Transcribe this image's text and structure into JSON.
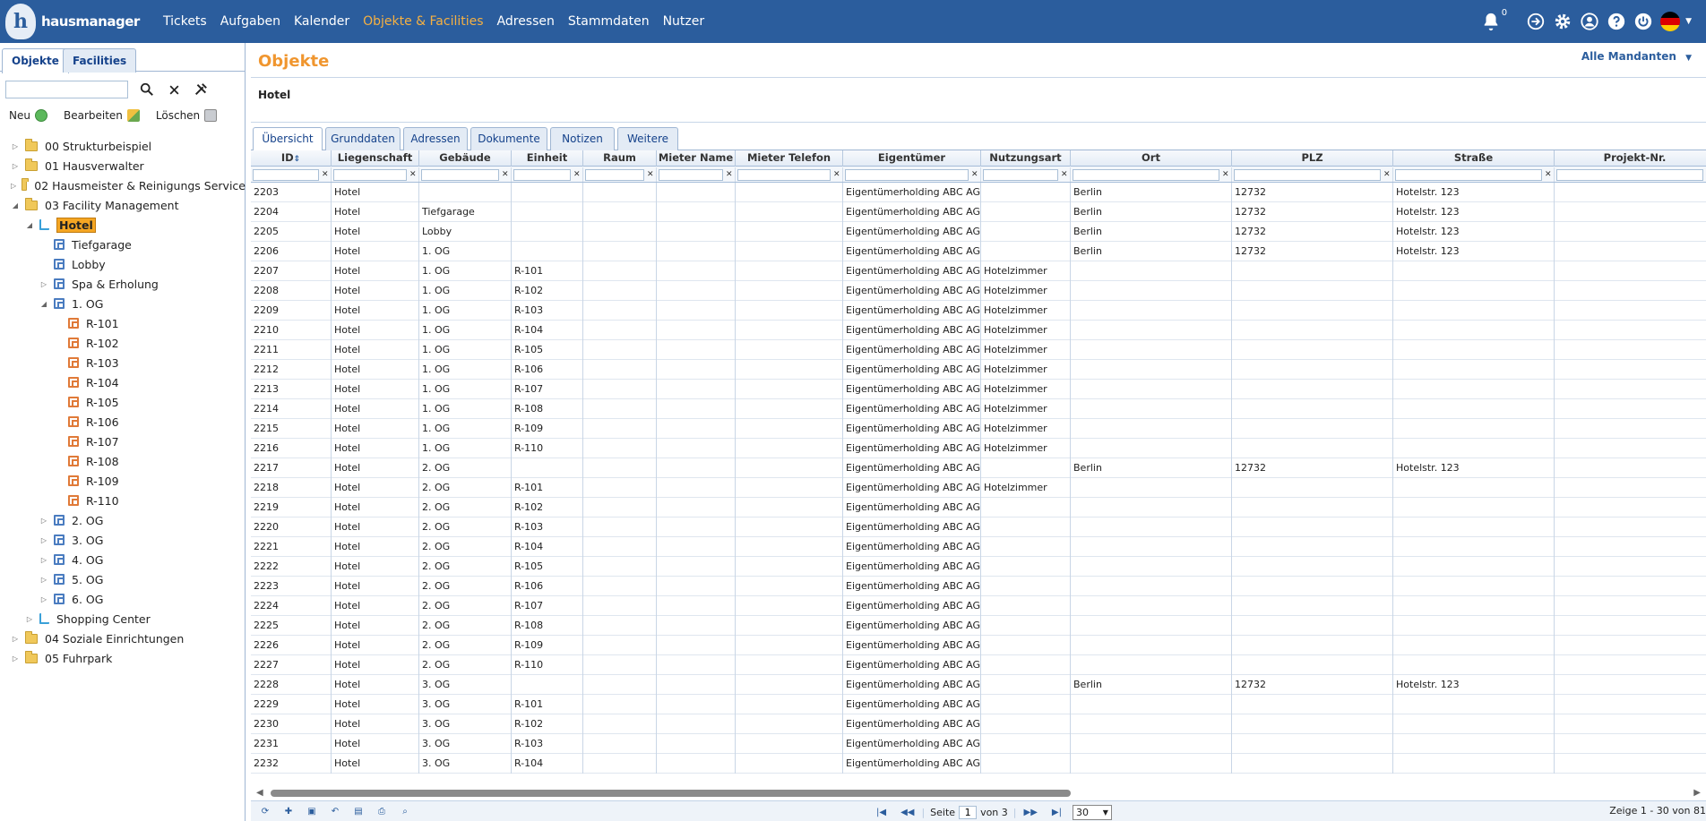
{
  "app": {
    "logo_text": "hausmanager",
    "logo_letter": "h"
  },
  "nav": [
    {
      "label": "Tickets",
      "active": false
    },
    {
      "label": "Aufgaben",
      "active": false
    },
    {
      "label": "Kalender",
      "active": false
    },
    {
      "label": "Objekte & Facilities",
      "active": true
    },
    {
      "label": "Adressen",
      "active": false
    },
    {
      "label": "Stammdaten",
      "active": false
    },
    {
      "label": "Nutzer",
      "active": false
    }
  ],
  "top_icons": {
    "bell_count": "0",
    "icons": [
      "bell-icon",
      "login-icon",
      "gear-icon",
      "user-icon",
      "help-icon",
      "power-icon",
      "flag-de-icon"
    ]
  },
  "left": {
    "tabs": [
      "Objekte",
      "Facilities"
    ],
    "search_value": "",
    "actions": {
      "new": "Neu",
      "edit": "Bearbeiten",
      "delete": "Löschen"
    },
    "tree": [
      {
        "label": "00 Strukturbeispiel",
        "level": 0,
        "toggle": "closed",
        "icon": "folder"
      },
      {
        "label": "01 Hausverwalter",
        "level": 0,
        "toggle": "closed",
        "icon": "folder"
      },
      {
        "label": "02 Hausmeister & Reinigungs Service",
        "level": 0,
        "toggle": "closed",
        "icon": "folder"
      },
      {
        "label": "03 Facility Management",
        "level": 0,
        "toggle": "open",
        "icon": "folder"
      },
      {
        "label": "Hotel",
        "level": 1,
        "toggle": "open",
        "icon": "prop",
        "selected": true
      },
      {
        "label": "Tiefgarage",
        "level": 2,
        "toggle": "none",
        "icon": "bldg"
      },
      {
        "label": "Lobby",
        "level": 2,
        "toggle": "none",
        "icon": "bldg"
      },
      {
        "label": "Spa & Erholung",
        "level": 2,
        "toggle": "closed",
        "icon": "bldg"
      },
      {
        "label": "1. OG",
        "level": 2,
        "toggle": "open",
        "icon": "bldg"
      },
      {
        "label": "R-101",
        "level": 3,
        "toggle": "none",
        "icon": "unit"
      },
      {
        "label": "R-102",
        "level": 3,
        "toggle": "none",
        "icon": "unit"
      },
      {
        "label": "R-103",
        "level": 3,
        "toggle": "none",
        "icon": "unit"
      },
      {
        "label": "R-104",
        "level": 3,
        "toggle": "none",
        "icon": "unit"
      },
      {
        "label": "R-105",
        "level": 3,
        "toggle": "none",
        "icon": "unit"
      },
      {
        "label": "R-106",
        "level": 3,
        "toggle": "none",
        "icon": "unit"
      },
      {
        "label": "R-107",
        "level": 3,
        "toggle": "none",
        "icon": "unit"
      },
      {
        "label": "R-108",
        "level": 3,
        "toggle": "none",
        "icon": "unit"
      },
      {
        "label": "R-109",
        "level": 3,
        "toggle": "none",
        "icon": "unit"
      },
      {
        "label": "R-110",
        "level": 3,
        "toggle": "none",
        "icon": "unit"
      },
      {
        "label": "2. OG",
        "level": 2,
        "toggle": "closed",
        "icon": "bldg"
      },
      {
        "label": "3. OG",
        "level": 2,
        "toggle": "closed",
        "icon": "bldg"
      },
      {
        "label": "4. OG",
        "level": 2,
        "toggle": "closed",
        "icon": "bldg"
      },
      {
        "label": "5. OG",
        "level": 2,
        "toggle": "closed",
        "icon": "bldg"
      },
      {
        "label": "6. OG",
        "level": 2,
        "toggle": "closed",
        "icon": "bldg"
      },
      {
        "label": "Shopping Center",
        "level": 1,
        "toggle": "closed",
        "icon": "prop"
      },
      {
        "label": "04 Soziale Einrichtungen",
        "level": 0,
        "toggle": "closed",
        "icon": "folder"
      },
      {
        "label": "05 Fuhrpark",
        "level": 0,
        "toggle": "closed",
        "icon": "folder"
      }
    ]
  },
  "main": {
    "title": "Objekte",
    "mandanten": "Alle Mandanten",
    "object_name": "Hotel",
    "tabs": [
      "Übersicht",
      "Grunddaten",
      "Adressen",
      "Dokumente",
      "Notizen",
      "Weitere"
    ],
    "columns": [
      "ID",
      "Liegenschaft",
      "Gebäude",
      "Einheit",
      "Raum",
      "Mieter Name",
      "Mieter Telefon",
      "Eigentümer",
      "Nutzungsart",
      "Ort",
      "PLZ",
      "Straße",
      "Projekt-Nr."
    ],
    "rows": [
      [
        "2203",
        "Hotel",
        "",
        "",
        "",
        "",
        "",
        "Eigentümerholding ABC AG",
        "",
        "Berlin",
        "12732",
        "Hotelstr. 123",
        ""
      ],
      [
        "2204",
        "Hotel",
        "Tiefgarage",
        "",
        "",
        "",
        "",
        "Eigentümerholding ABC AG",
        "",
        "Berlin",
        "12732",
        "Hotelstr. 123",
        ""
      ],
      [
        "2205",
        "Hotel",
        "Lobby",
        "",
        "",
        "",
        "",
        "Eigentümerholding ABC AG",
        "",
        "Berlin",
        "12732",
        "Hotelstr. 123",
        ""
      ],
      [
        "2206",
        "Hotel",
        "1. OG",
        "",
        "",
        "",
        "",
        "Eigentümerholding ABC AG",
        "",
        "Berlin",
        "12732",
        "Hotelstr. 123",
        ""
      ],
      [
        "2207",
        "Hotel",
        "1. OG",
        "R-101",
        "",
        "",
        "",
        "Eigentümerholding ABC AG",
        "Hotelzimmer",
        "",
        "",
        "",
        ""
      ],
      [
        "2208",
        "Hotel",
        "1. OG",
        "R-102",
        "",
        "",
        "",
        "Eigentümerholding ABC AG",
        "Hotelzimmer",
        "",
        "",
        "",
        ""
      ],
      [
        "2209",
        "Hotel",
        "1. OG",
        "R-103",
        "",
        "",
        "",
        "Eigentümerholding ABC AG",
        "Hotelzimmer",
        "",
        "",
        "",
        ""
      ],
      [
        "2210",
        "Hotel",
        "1. OG",
        "R-104",
        "",
        "",
        "",
        "Eigentümerholding ABC AG",
        "Hotelzimmer",
        "",
        "",
        "",
        ""
      ],
      [
        "2211",
        "Hotel",
        "1. OG",
        "R-105",
        "",
        "",
        "",
        "Eigentümerholding ABC AG",
        "Hotelzimmer",
        "",
        "",
        "",
        ""
      ],
      [
        "2212",
        "Hotel",
        "1. OG",
        "R-106",
        "",
        "",
        "",
        "Eigentümerholding ABC AG",
        "Hotelzimmer",
        "",
        "",
        "",
        ""
      ],
      [
        "2213",
        "Hotel",
        "1. OG",
        "R-107",
        "",
        "",
        "",
        "Eigentümerholding ABC AG",
        "Hotelzimmer",
        "",
        "",
        "",
        ""
      ],
      [
        "2214",
        "Hotel",
        "1. OG",
        "R-108",
        "",
        "",
        "",
        "Eigentümerholding ABC AG",
        "Hotelzimmer",
        "",
        "",
        "",
        ""
      ],
      [
        "2215",
        "Hotel",
        "1. OG",
        "R-109",
        "",
        "",
        "",
        "Eigentümerholding ABC AG",
        "Hotelzimmer",
        "",
        "",
        "",
        ""
      ],
      [
        "2216",
        "Hotel",
        "1. OG",
        "R-110",
        "",
        "",
        "",
        "Eigentümerholding ABC AG",
        "Hotelzimmer",
        "",
        "",
        "",
        ""
      ],
      [
        "2217",
        "Hotel",
        "2. OG",
        "",
        "",
        "",
        "",
        "Eigentümerholding ABC AG",
        "",
        "Berlin",
        "12732",
        "Hotelstr. 123",
        ""
      ],
      [
        "2218",
        "Hotel",
        "2. OG",
        "R-101",
        "",
        "",
        "",
        "Eigentümerholding ABC AG",
        "Hotelzimmer",
        "",
        "",
        "",
        ""
      ],
      [
        "2219",
        "Hotel",
        "2. OG",
        "R-102",
        "",
        "",
        "",
        "Eigentümerholding ABC AG",
        "",
        "",
        "",
        "",
        ""
      ],
      [
        "2220",
        "Hotel",
        "2. OG",
        "R-103",
        "",
        "",
        "",
        "Eigentümerholding ABC AG",
        "",
        "",
        "",
        "",
        ""
      ],
      [
        "2221",
        "Hotel",
        "2. OG",
        "R-104",
        "",
        "",
        "",
        "Eigentümerholding ABC AG",
        "",
        "",
        "",
        "",
        ""
      ],
      [
        "2222",
        "Hotel",
        "2. OG",
        "R-105",
        "",
        "",
        "",
        "Eigentümerholding ABC AG",
        "",
        "",
        "",
        "",
        ""
      ],
      [
        "2223",
        "Hotel",
        "2. OG",
        "R-106",
        "",
        "",
        "",
        "Eigentümerholding ABC AG",
        "",
        "",
        "",
        "",
        ""
      ],
      [
        "2224",
        "Hotel",
        "2. OG",
        "R-107",
        "",
        "",
        "",
        "Eigentümerholding ABC AG",
        "",
        "",
        "",
        "",
        ""
      ],
      [
        "2225",
        "Hotel",
        "2. OG",
        "R-108",
        "",
        "",
        "",
        "Eigentümerholding ABC AG",
        "",
        "",
        "",
        "",
        ""
      ],
      [
        "2226",
        "Hotel",
        "2. OG",
        "R-109",
        "",
        "",
        "",
        "Eigentümerholding ABC AG",
        "",
        "",
        "",
        "",
        ""
      ],
      [
        "2227",
        "Hotel",
        "2. OG",
        "R-110",
        "",
        "",
        "",
        "Eigentümerholding ABC AG",
        "",
        "",
        "",
        "",
        ""
      ],
      [
        "2228",
        "Hotel",
        "3. OG",
        "",
        "",
        "",
        "",
        "Eigentümerholding ABC AG",
        "",
        "Berlin",
        "12732",
        "Hotelstr. 123",
        ""
      ],
      [
        "2229",
        "Hotel",
        "3. OG",
        "R-101",
        "",
        "",
        "",
        "Eigentümerholding ABC AG",
        "",
        "",
        "",
        "",
        ""
      ],
      [
        "2230",
        "Hotel",
        "3. OG",
        "R-102",
        "",
        "",
        "",
        "Eigentümerholding ABC AG",
        "",
        "",
        "",
        "",
        ""
      ],
      [
        "2231",
        "Hotel",
        "3. OG",
        "R-103",
        "",
        "",
        "",
        "Eigentümerholding ABC AG",
        "",
        "",
        "",
        "",
        ""
      ],
      [
        "2232",
        "Hotel",
        "3. OG",
        "R-104",
        "",
        "",
        "",
        "Eigentümerholding ABC AG",
        "",
        "",
        "",
        "",
        ""
      ]
    ],
    "pager": {
      "page_label": "Seite",
      "page_value": "1",
      "of_label": "von 3",
      "page_size": "30",
      "info": "Zeige 1 - 30 von 81"
    }
  },
  "colors": {
    "topbar": "#2b5d9d",
    "accent": "#f0962f",
    "nav_active": "#f5b042",
    "selected": "#f5a623"
  }
}
